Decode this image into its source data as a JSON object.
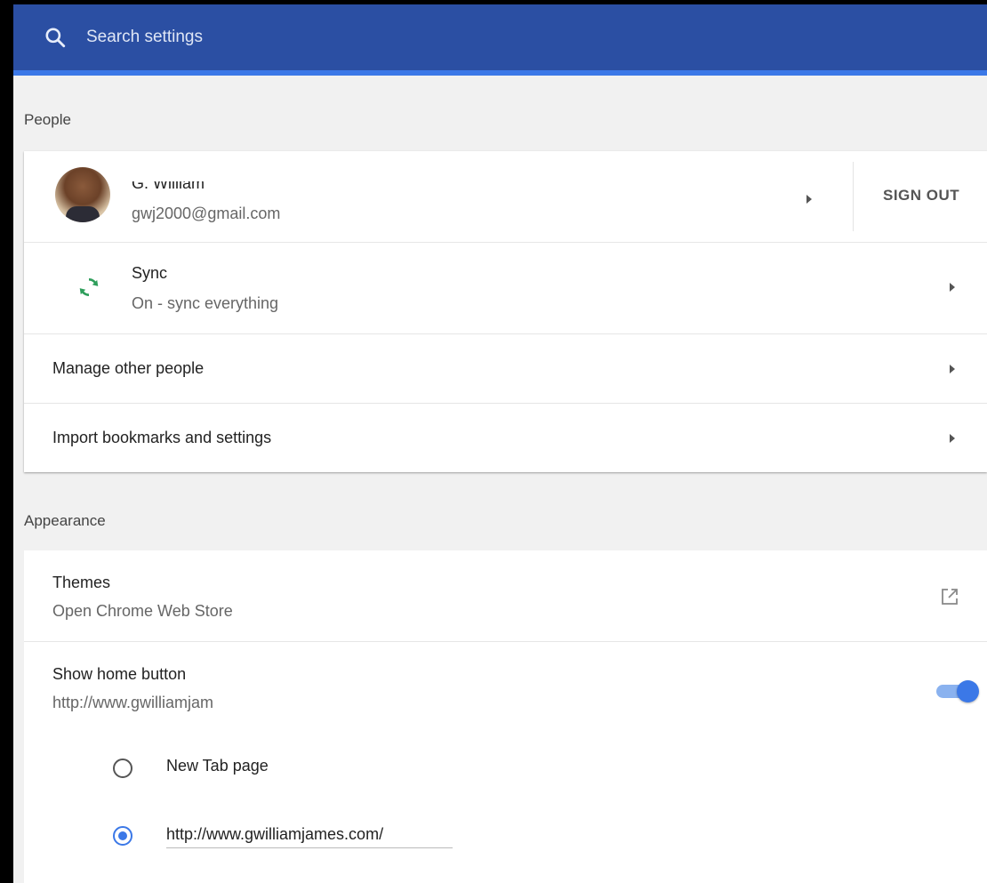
{
  "search": {
    "placeholder": "Search settings"
  },
  "people": {
    "title": "People",
    "account": {
      "name": "G. William",
      "email": "gwj2000@gmail.com",
      "sign_out_label": "SIGN OUT"
    },
    "sync": {
      "label": "Sync",
      "status": "On - sync everything"
    },
    "manage_label": "Manage other people",
    "import_label": "Import bookmarks and settings"
  },
  "appearance": {
    "title": "Appearance",
    "themes": {
      "label": "Themes",
      "sub": "Open Chrome Web Store"
    },
    "home_button": {
      "label": "Show home button",
      "sub": "http://www.gwilliamjames.com/",
      "enabled": true
    },
    "home_options": {
      "new_tab_label": "New Tab page",
      "custom_url_value": "http://www.gwilliamjames.com/",
      "selected": "custom"
    }
  },
  "colors": {
    "header_bg": "#2b4fa3",
    "accent": "#3b78e7",
    "sync_green": "#2e9e5b"
  },
  "icons": [
    "search-icon",
    "sync-icon",
    "chevron-right-icon",
    "open-in-new-icon"
  ]
}
